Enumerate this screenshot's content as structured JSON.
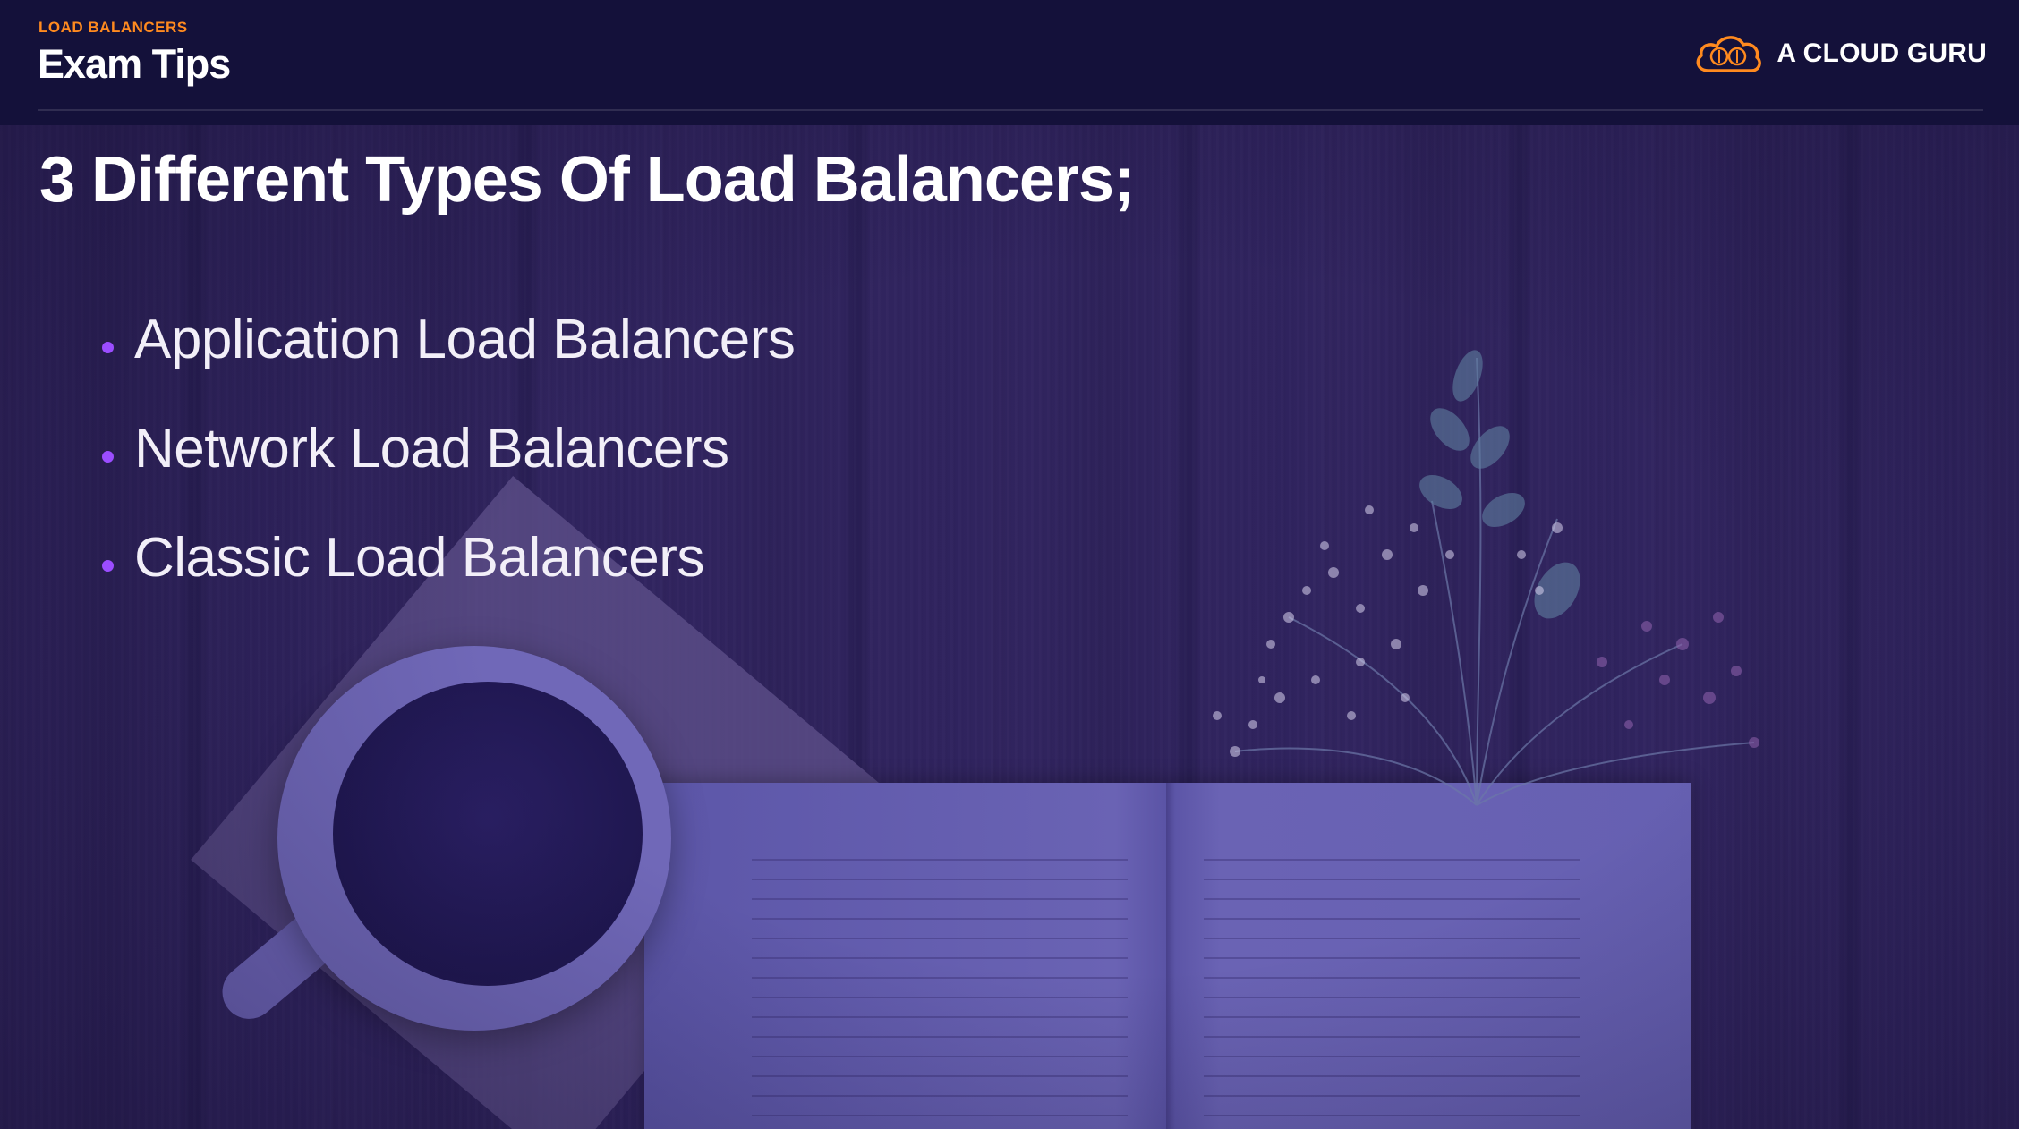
{
  "header": {
    "section_label": "LOAD BALANCERS",
    "title": "Exam Tips",
    "logo_icon": "cloud-icon",
    "logo_text": "A CLOUD GURU"
  },
  "main": {
    "title": "3 Different Types Of Load Balancers;",
    "bullets": [
      "Application Load Balancers",
      "Network Load Balancers",
      "Classic Load Balancers"
    ]
  },
  "colors": {
    "header_background": "#14113a",
    "section_label": "#ff8a1f",
    "bullet_accent": "#9b4dff",
    "logo_accent": "#ff8a1f"
  }
}
